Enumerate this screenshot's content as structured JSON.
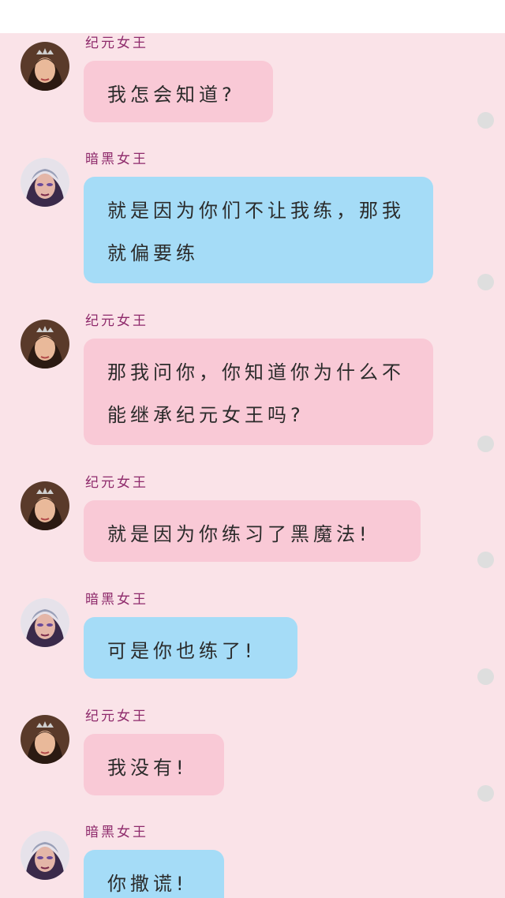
{
  "chat": {
    "messages": [
      {
        "sender": "纪元女王",
        "text": "我怎会知道?",
        "side": "pink"
      },
      {
        "sender": "暗黑女王",
        "text": "就是因为你们不让我练，那我就偏要练",
        "side": "blue"
      },
      {
        "sender": "纪元女王",
        "text": "那我问你，你知道你为什么不能继承纪元女王吗?",
        "side": "pink"
      },
      {
        "sender": "纪元女王",
        "text": "就是因为你练习了黑魔法!",
        "side": "pink"
      },
      {
        "sender": "暗黑女王",
        "text": "可是你也练了!",
        "side": "blue"
      },
      {
        "sender": "纪元女王",
        "text": "我没有!",
        "side": "pink"
      },
      {
        "sender": "暗黑女王",
        "text": "你撒谎!",
        "side": "blue"
      }
    ]
  },
  "colors": {
    "background": "#fae3e8",
    "pink_bubble": "#f9c9d6",
    "blue_bubble": "#a5dcf7",
    "sender_name": "#8e2a6b",
    "status_dot": "#dedede"
  },
  "icons": {
    "avatar_eon_queen": "eon-queen-avatar",
    "avatar_dark_queen": "dark-queen-avatar",
    "read_dot": "status-dot-icon"
  }
}
